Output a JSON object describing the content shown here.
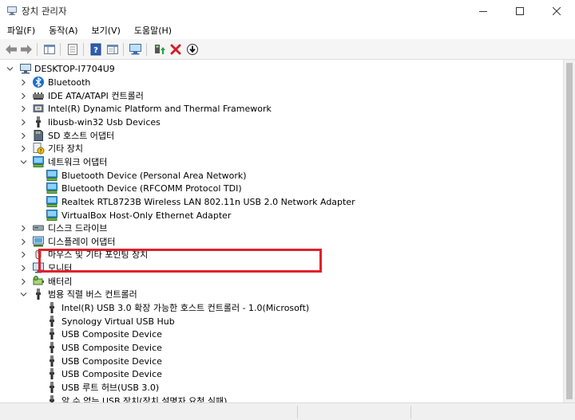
{
  "window": {
    "title": "장치 관리자"
  },
  "menu": [
    {
      "label": "파일(F)",
      "name": "menu-file"
    },
    {
      "label": "동작(A)",
      "name": "menu-action"
    },
    {
      "label": "보기(V)",
      "name": "menu-view"
    },
    {
      "label": "도움말(H)",
      "name": "menu-help"
    }
  ],
  "tree": {
    "root": "DESKTOP-I7704U9",
    "items": [
      {
        "label": "Bluetooth",
        "level": 1,
        "expand": "collapsed",
        "icon": "bluetooth-icon"
      },
      {
        "label": "IDE ATA/ATAPI 컨트롤러",
        "level": 1,
        "expand": "collapsed",
        "icon": "ide-controller-icon"
      },
      {
        "label": "Intel(R) Dynamic Platform and Thermal Framework",
        "level": 1,
        "expand": "collapsed",
        "icon": "chip-icon"
      },
      {
        "label": "libusb-win32 Usb Devices",
        "level": 1,
        "expand": "collapsed",
        "icon": "usb-plug-icon"
      },
      {
        "label": "SD 호스트 어댑터",
        "level": 1,
        "expand": "collapsed",
        "icon": "sd-host-icon"
      },
      {
        "label": "기타 장치",
        "level": 1,
        "expand": "collapsed",
        "icon": "unknown-device-icon"
      },
      {
        "label": "네트워크 어댑터",
        "level": 1,
        "expand": "expanded",
        "icon": "network-adapter-icon"
      },
      {
        "label": "Bluetooth Device (Personal Area Network)",
        "level": 2,
        "expand": "none",
        "icon": "network-adapter-icon"
      },
      {
        "label": "Bluetooth Device (RFCOMM Protocol TDI)",
        "level": 2,
        "expand": "none",
        "icon": "network-adapter-icon"
      },
      {
        "label": "Realtek RTL8723B Wireless LAN 802.11n USB 2.0 Network Adapter",
        "level": 2,
        "expand": "none",
        "icon": "network-adapter-icon"
      },
      {
        "label": "VirtualBox Host-Only Ethernet Adapter",
        "level": 2,
        "expand": "none",
        "icon": "network-adapter-icon"
      },
      {
        "label": "디스크 드라이브",
        "level": 1,
        "expand": "collapsed",
        "icon": "disk-drive-icon"
      },
      {
        "label": "디스플레이 어댑터",
        "level": 1,
        "expand": "collapsed",
        "icon": "display-adapter-icon"
      },
      {
        "label": "마우스 및 기타 포인팅 장치",
        "level": 1,
        "expand": "collapsed",
        "icon": "mouse-icon"
      },
      {
        "label": "모니터",
        "level": 1,
        "expand": "collapsed",
        "icon": "monitor-icon"
      },
      {
        "label": "배터리",
        "level": 1,
        "expand": "collapsed",
        "icon": "battery-icon"
      },
      {
        "label": "범용 직렬 버스 컨트롤러",
        "level": 1,
        "expand": "expanded",
        "icon": "usb-plug-icon"
      },
      {
        "label": "Intel(R) USB 3.0 확장 가능한 호스트 컨트롤러 - 1.0(Microsoft)",
        "level": 2,
        "expand": "none",
        "icon": "usb-plug-icon"
      },
      {
        "label": "Synology Virtual USB Hub",
        "level": 2,
        "expand": "none",
        "icon": "usb-plug-icon"
      },
      {
        "label": "USB Composite Device",
        "level": 2,
        "expand": "none",
        "icon": "usb-plug-icon"
      },
      {
        "label": "USB Composite Device",
        "level": 2,
        "expand": "none",
        "icon": "usb-plug-icon"
      },
      {
        "label": "USB Composite Device",
        "level": 2,
        "expand": "none",
        "icon": "usb-plug-icon"
      },
      {
        "label": "USB Composite Device",
        "level": 2,
        "expand": "none",
        "icon": "usb-plug-icon"
      },
      {
        "label": "USB 루트 허브(USB 3.0)",
        "level": 2,
        "expand": "none",
        "icon": "usb-plug-icon"
      },
      {
        "label": "알 수 없는 USB 장치(장치 설명자 요청 실패)",
        "level": 2,
        "expand": "none",
        "icon": "usb-plug-icon"
      }
    ]
  },
  "colors": {
    "highlight_border": "#e2202a",
    "accent": "#1a6fc9"
  }
}
